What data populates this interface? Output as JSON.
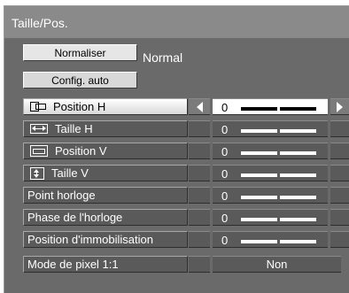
{
  "window": {
    "title": "Taille/Pos."
  },
  "buttons": {
    "normalize_label": "Normaliser",
    "normalize_value": "Normal",
    "auto_config_label": "Config. auto"
  },
  "rows": [
    {
      "label": "Position H",
      "icon": "position-h-icon",
      "value": "0",
      "selected": true,
      "slider_fraction": 0.5
    },
    {
      "label": "Taille H",
      "icon": "taille-h-icon",
      "value": "0",
      "slider_fraction": 0.5
    },
    {
      "label": "Position V",
      "icon": "position-v-icon",
      "value": "0",
      "slider_fraction": 0.5
    },
    {
      "label": "Taille V",
      "icon": "taille-v-icon",
      "value": "0",
      "slider_fraction": 0.5
    },
    {
      "label": "Point horloge",
      "value": "0",
      "slider_fraction": 0.5
    },
    {
      "label": "Phase de l'horloge",
      "value": "0",
      "slider_fraction": 0.5
    },
    {
      "label": "Position d'immobilisation",
      "value": "0",
      "slider_fraction": 0.5
    },
    {
      "label": "Mode de pixel 1:1",
      "value": "Non"
    }
  ],
  "colors": {
    "panel_bg": "#6a6a6a",
    "header_bg": "#8a8a8a",
    "row_bg": "#5a5a5a",
    "selected_bg": "#ffffff"
  }
}
